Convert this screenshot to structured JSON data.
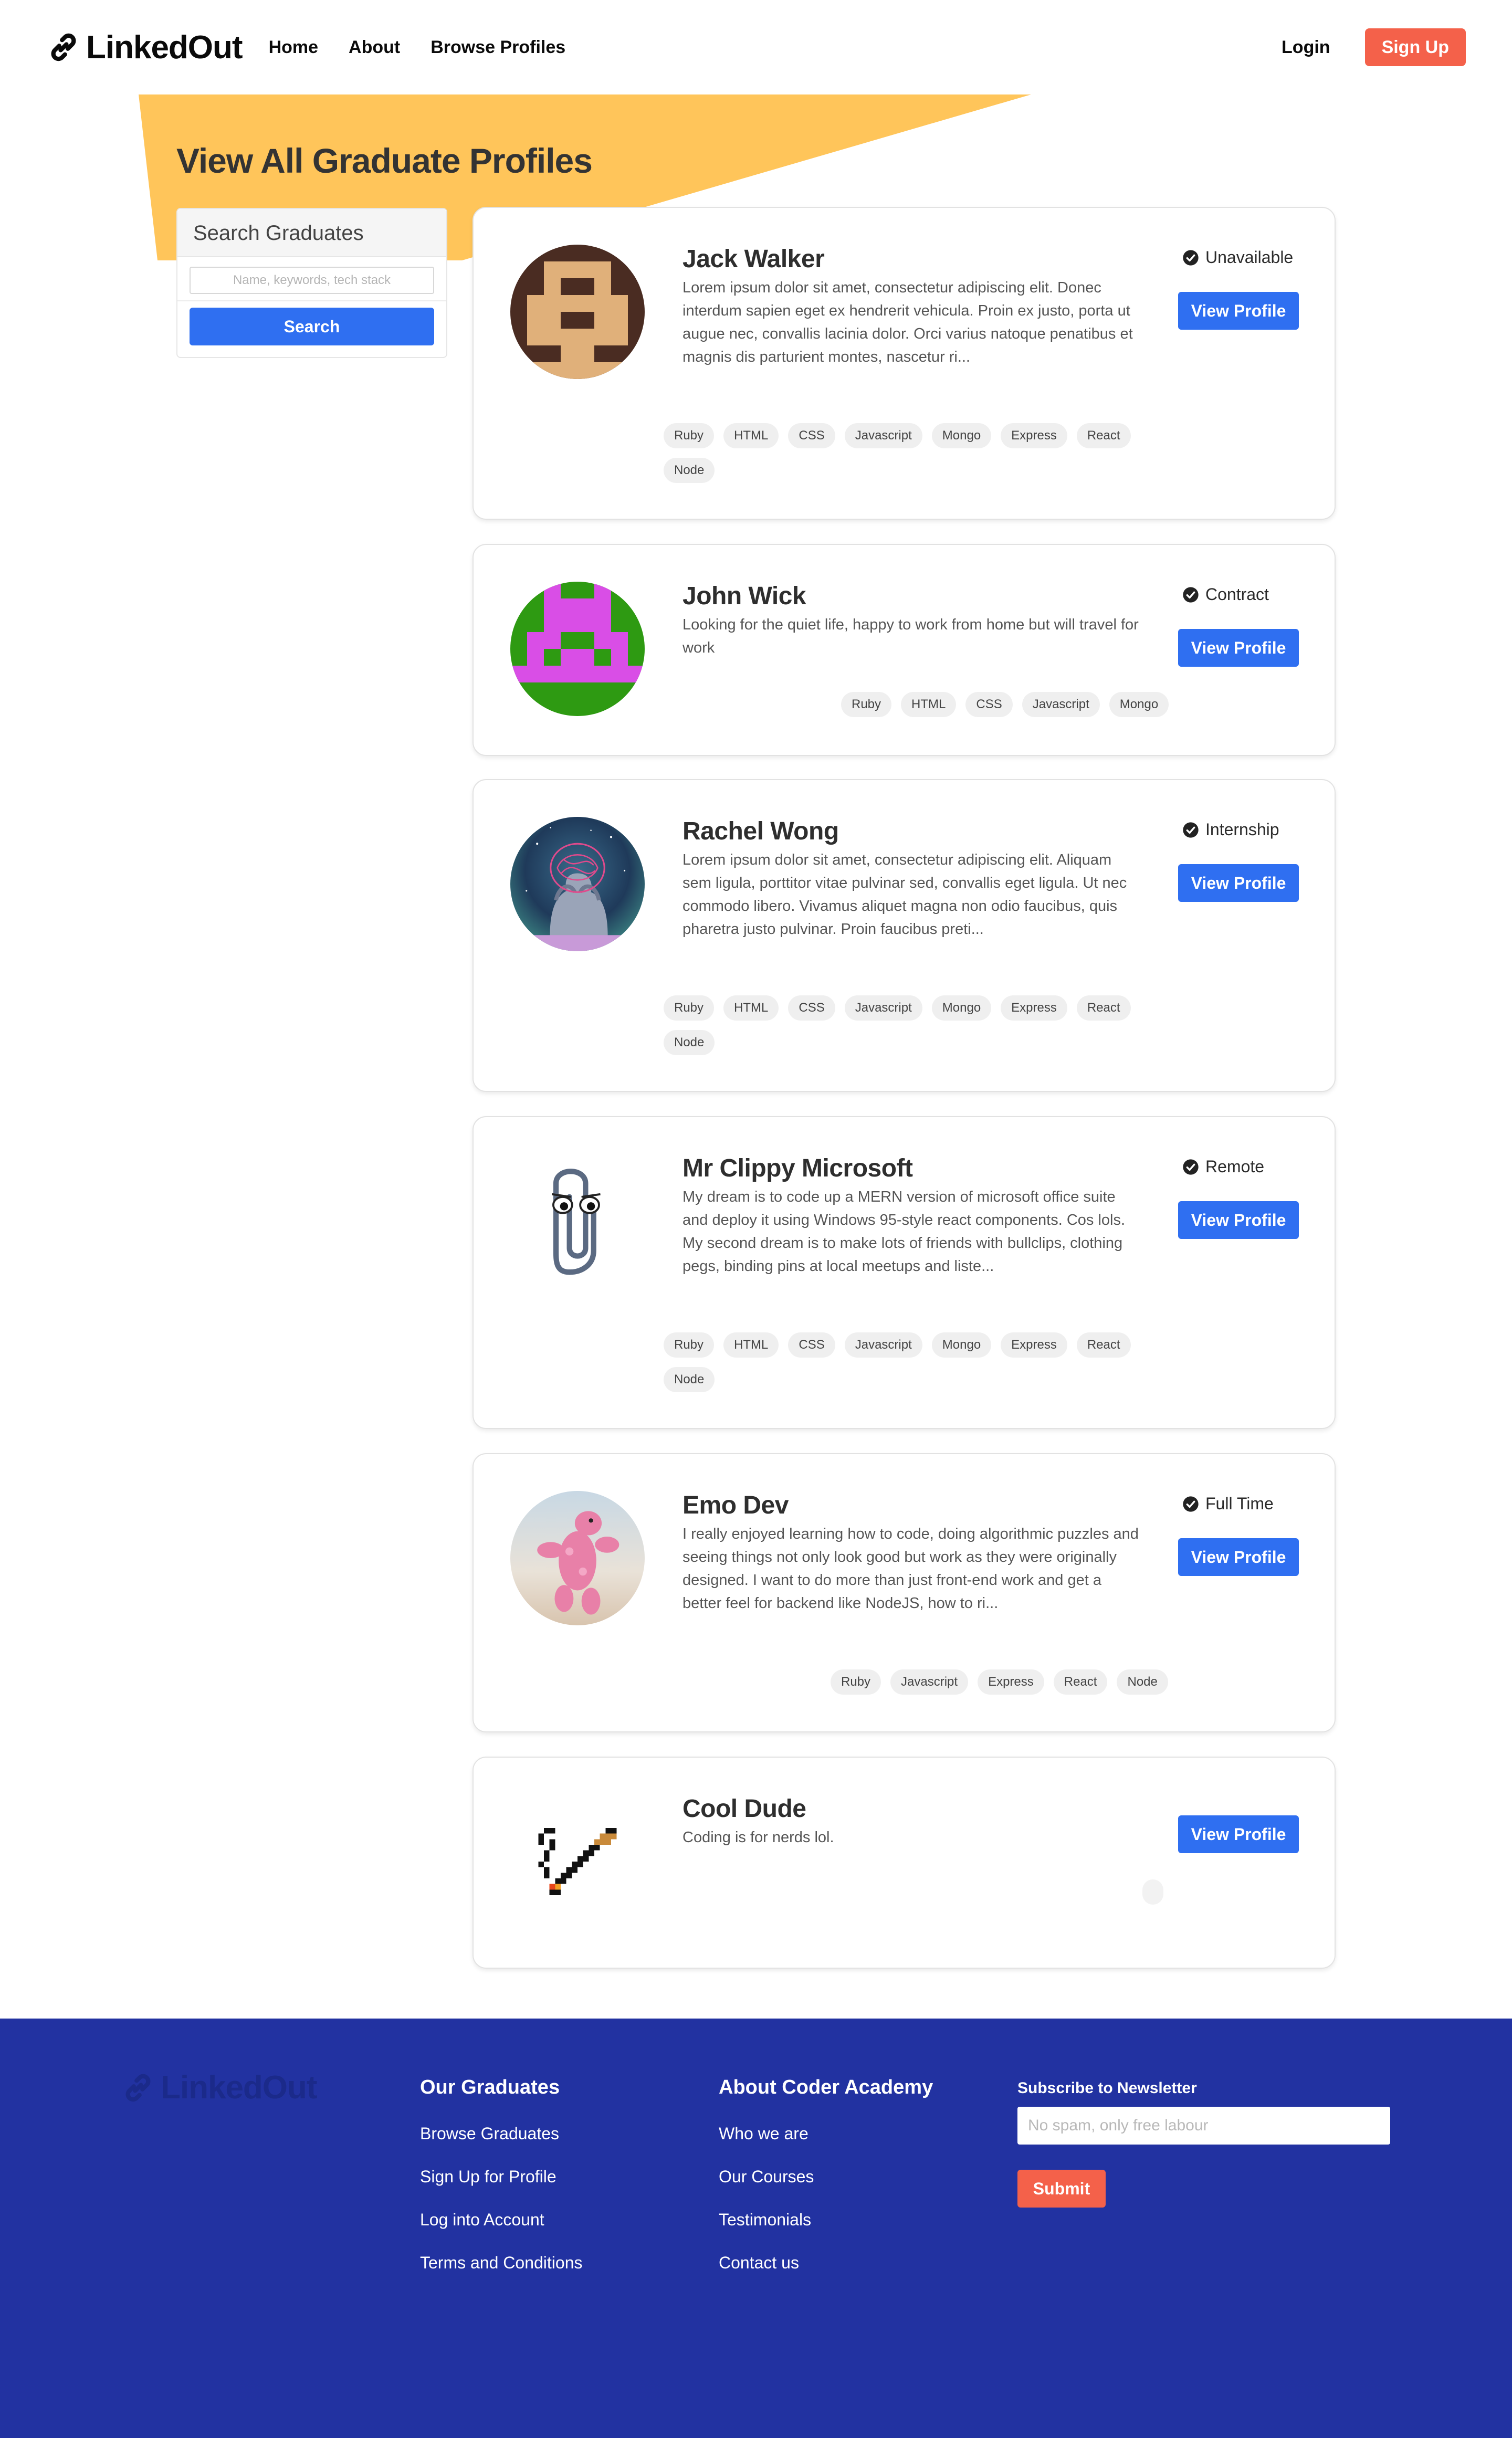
{
  "colors": {
    "accent": "#2f6ff1",
    "signup": "#f4614a",
    "banner": "#ffc55a",
    "footer": "#2232a1"
  },
  "nav": {
    "brand": "LinkedOut",
    "links": [
      "Home",
      "About",
      "Browse Profiles"
    ],
    "login": "Login",
    "signup": "Sign Up"
  },
  "page": {
    "title": "View All Graduate Profiles"
  },
  "search": {
    "heading": "Search Graduates",
    "placeholder": "Name, keywords, tech stack",
    "button": "Search"
  },
  "profiles": [
    {
      "name": "Jack Walker",
      "status": "Unavailable",
      "bio": "Lorem ipsum dolor sit amet, consectetur adipiscing elit. Donec interdum sapien eget ex hendrerit vehicula. Proin ex justo, porta ut augue nec, convallis lacinia dolor. Orci varius natoque penatibus et magnis dis parturient montes, nascetur ri...",
      "button": "View Profile",
      "avatar": "pixel-face-avatar",
      "tags": [
        "Ruby",
        "HTML",
        "CSS",
        "Javascript",
        "Mongo",
        "Express",
        "React",
        "Node"
      ]
    },
    {
      "name": "John Wick",
      "status": "Contract",
      "bio": "Looking for the quiet life, happy to work from home but will travel for work",
      "button": "View Profile",
      "avatar": "pixel-invader-avatar",
      "tags": [
        "Ruby",
        "HTML",
        "CSS",
        "Javascript",
        "Mongo"
      ]
    },
    {
      "name": "Rachel Wong",
      "status": "Internship",
      "bio": "Lorem ipsum dolor sit amet, consectetur adipiscing elit. Aliquam sem ligula, porttitor vitae pulvinar sed, convallis eget ligula. Ut nec commodo libero. Vivamus aliquet magna non odio faucibus, quis pharetra justo pulvinar. Proin faucibus preti...",
      "button": "View Profile",
      "avatar": "illustration-avatar",
      "tags": [
        "Ruby",
        "HTML",
        "CSS",
        "Javascript",
        "Mongo",
        "Express",
        "React",
        "Node"
      ]
    },
    {
      "name": "Mr Clippy Microsoft",
      "status": "Remote",
      "bio": "My dream is to code up a MERN version of microsoft office suite and deploy it using Windows 95-style react components. Cos lols. My second dream is to make lots of friends with bullclips, clothing pegs, binding pins at local meetups and liste...",
      "button": "View Profile",
      "avatar": "paperclip-avatar",
      "tags": [
        "Ruby",
        "HTML",
        "CSS",
        "Javascript",
        "Mongo",
        "Express",
        "React",
        "Node"
      ]
    },
    {
      "name": "Emo Dev",
      "status": "Full Time",
      "bio": "I really enjoyed learning how to code, doing algorithmic puzzles and seeing things not only look good but work as they were originally designed. I want to do more than just front-end work and get a better feel for backend like NodeJS, how to ri...",
      "button": "View Profile",
      "avatar": "pink-creature-avatar",
      "tags": [
        "Ruby",
        "Javascript",
        "Express",
        "React",
        "Node"
      ]
    },
    {
      "name": "Cool Dude",
      "status": "",
      "bio": "Coding is for nerds lol.",
      "button": "View Profile",
      "avatar": "pixel-cigarette-avatar",
      "tags": []
    }
  ],
  "footer": {
    "brand": "LinkedOut",
    "graduates": {
      "heading": "Our Graduates",
      "links": [
        "Browse Graduates",
        "Sign Up for Profile",
        "Log into Account",
        "Terms and Conditions"
      ]
    },
    "academy": {
      "heading": "About Coder Academy",
      "links": [
        "Who we are",
        "Our Courses",
        "Testimonials",
        "Contact us"
      ]
    },
    "newsletter": {
      "label": "Subscribe to Newsletter",
      "placeholder": "No spam, only free labour",
      "button": "Submit"
    }
  }
}
